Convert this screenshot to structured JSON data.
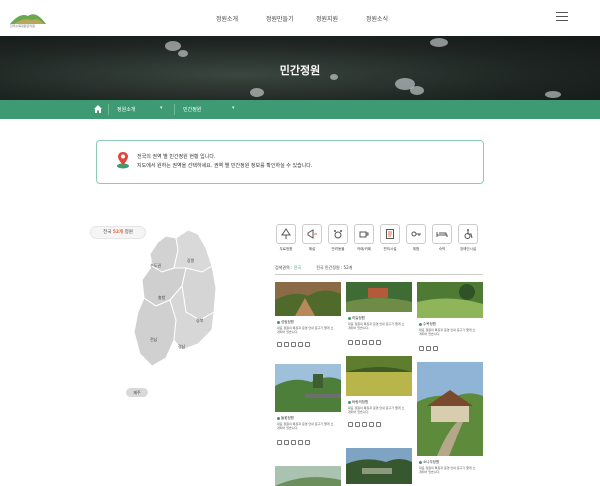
{
  "header": {
    "logo_text": "한국수목정원관리원",
    "nav": [
      "정원소개",
      "정원만들기",
      "정원지원",
      "정원소식"
    ]
  },
  "hero": {
    "title": "민간정원"
  },
  "subnav": {
    "item1": "정원소개",
    "item2": "민간정원"
  },
  "notice": {
    "line1": "전국의 권역 별 민간정원 현황 입니다.",
    "line2": "지도에서 원하는 권역을 선택하세요. 권역 별 민간정원 정보를 확인하실 수 있습니다."
  },
  "map": {
    "count_prefix": "전국",
    "count": "52개",
    "count_suffix": "정원",
    "regions": [
      "수도권",
      "강원",
      "충청",
      "경북",
      "전남",
      "경남"
    ],
    "jeju": "제주"
  },
  "categories": [
    "무료정원",
    "해설",
    "반려동물",
    "카페/카페",
    "편의시설",
    "체험",
    "숙박",
    "교통/주차",
    "장애인시설"
  ],
  "filter": {
    "prefix": "검색권역 :",
    "region": "전국",
    "count_text": "전국 민간정원 : 52개"
  },
  "cards": [
    {
      "name": "성림정원",
      "desc": "대표 정원의 특징과 운영 안내 문구가 짧게 소개되어 있습니다."
    },
    {
      "name": "하늘정원",
      "desc": "대표 정원의 특징과 운영 안내 문구가 짧게 소개되어 있습니다."
    },
    {
      "name": "수목정원",
      "desc": "대표 정원의 특징과 운영 안내 문구가 짧게 소개되어 있습니다."
    },
    {
      "name": "들꽃정원",
      "desc": "대표 정원의 특징과 운영 안내 문구가 짧게 소개되어 있습니다."
    },
    {
      "name": "바람의정원",
      "desc": "대표 정원의 특징과 운영 안내 문구가 짧게 소개되어 있습니다."
    },
    {
      "name": "소나무정원",
      "desc": "대표 정원의 특징과 운영 안내 문구가 짧게 소개되어 있습니다."
    }
  ]
}
